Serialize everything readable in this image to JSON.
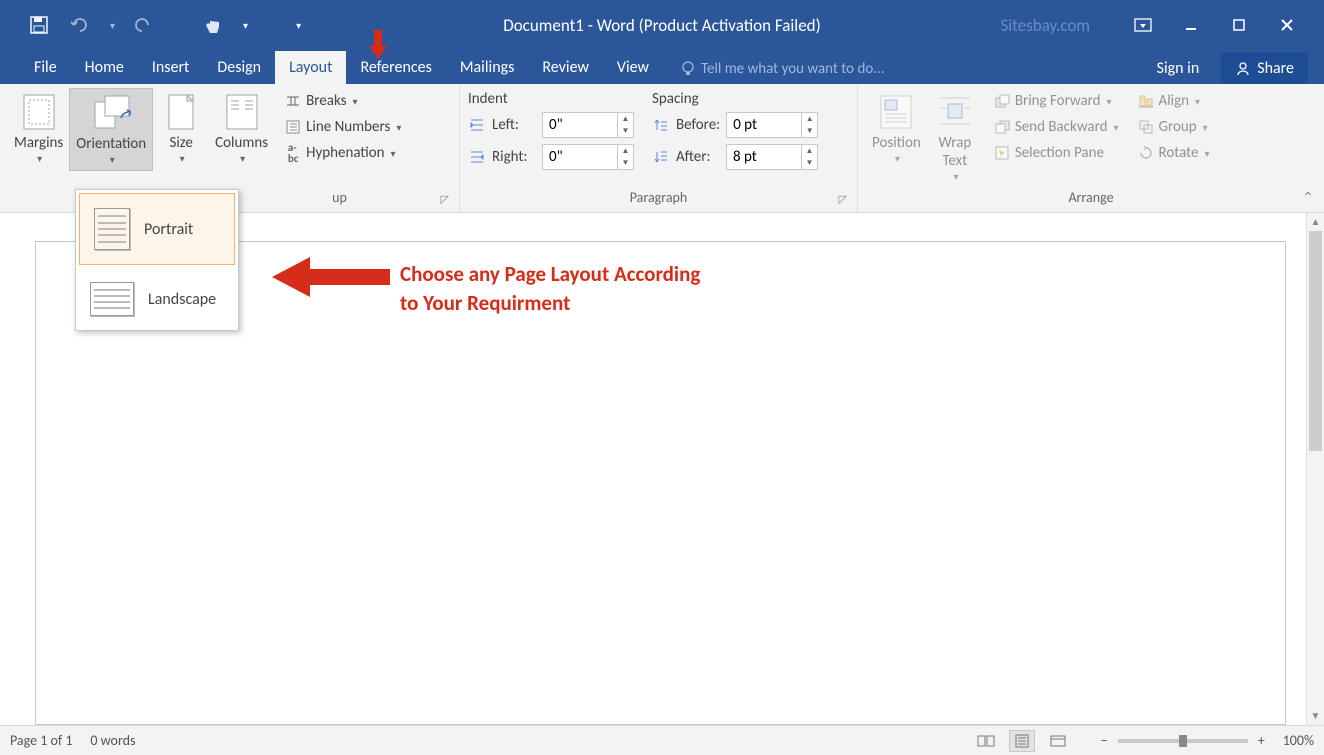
{
  "titlebar": {
    "title": "Document1 - Word (Product Activation Failed)",
    "watermark": "Sitesbay.com"
  },
  "tabs": {
    "file": "File",
    "home": "Home",
    "insert": "Insert",
    "design": "Design",
    "layout": "Layout",
    "references": "References",
    "mailings": "Mailings",
    "review": "Review",
    "view": "View",
    "tellme": "Tell me what you want to do...",
    "signin": "Sign in",
    "share": "Share"
  },
  "ribbon": {
    "pagesetup": {
      "margins": "Margins",
      "orientation": "Orientation",
      "size": "Size",
      "columns": "Columns",
      "breaks": "Breaks",
      "linenumbers": "Line Numbers",
      "hyphenation": "Hyphenation",
      "group_label_suffix": "up"
    },
    "paragraph": {
      "indent_label": "Indent",
      "spacing_label": "Spacing",
      "left_label": "Left:",
      "right_label": "Right:",
      "before_label": "Before:",
      "after_label": "After:",
      "left_value": "0\"",
      "right_value": "0\"",
      "before_value": "0 pt",
      "after_value": "8 pt",
      "group_label": "Paragraph"
    },
    "arrange": {
      "position": "Position",
      "wraptext": "Wrap Text",
      "bringforward": "Bring Forward",
      "sendbackward": "Send Backward",
      "selectionpane": "Selection Pane",
      "align": "Align",
      "group": "Group",
      "rotate": "Rotate",
      "group_label": "Arrange"
    }
  },
  "orientation_menu": {
    "portrait": "Portrait",
    "landscape": "Landscape"
  },
  "annotation": {
    "line1": "Choose any Page Layout According",
    "line2": "to Your Requirment"
  },
  "statusbar": {
    "page": "Page 1 of 1",
    "words": "0 words",
    "zoom": "100%",
    "minus": "−",
    "plus": "+"
  }
}
